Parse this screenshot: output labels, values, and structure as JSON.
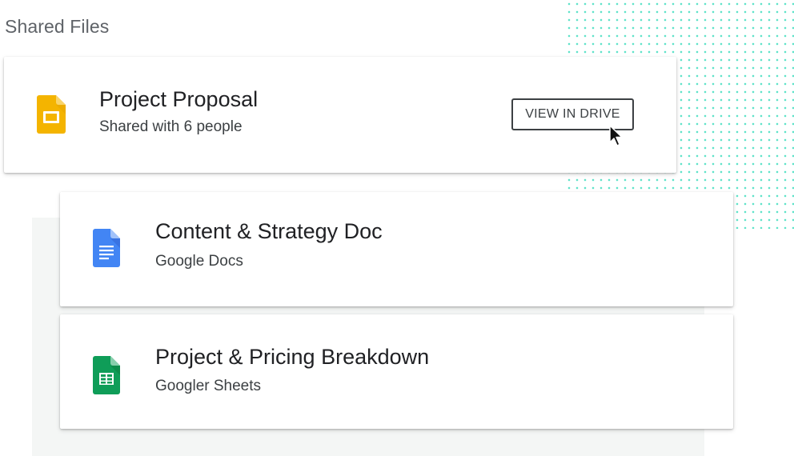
{
  "section": {
    "title": "Shared Files"
  },
  "files": [
    {
      "title": "Project Proposal",
      "subtitle": "Shared with 6 people",
      "icon": "google-slides-icon",
      "icon_color": "#f4b400",
      "action_label": "VIEW IN DRIVE"
    },
    {
      "title": "Content & Strategy Doc",
      "subtitle": "Google Docs",
      "icon": "google-docs-icon",
      "icon_color": "#4285f4"
    },
    {
      "title": "Project & Pricing Breakdown",
      "subtitle": "Googler Sheets",
      "icon": "google-sheets-icon",
      "icon_color": "#0f9d58"
    }
  ],
  "colors": {
    "dot_pattern": "#5fe3c9",
    "panel_background": "#f4f6f5",
    "title_text": "#202124",
    "subtitle_text": "#3c4043"
  }
}
